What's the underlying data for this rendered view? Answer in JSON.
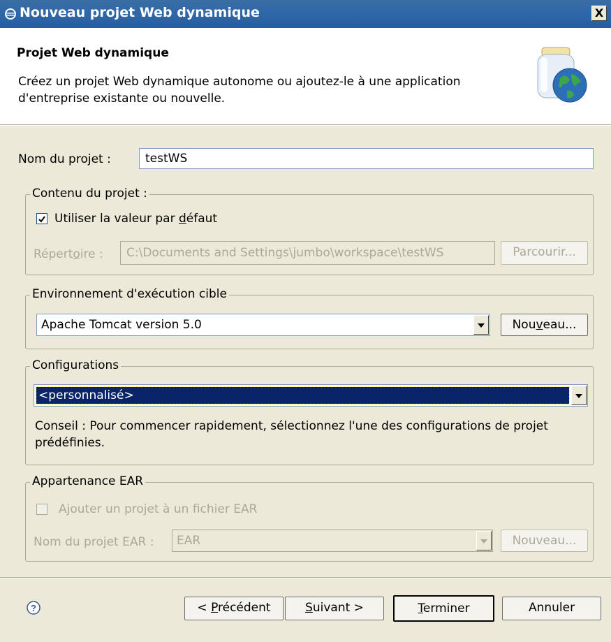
{
  "window": {
    "title": "Nouveau projet Web dynamique",
    "close_label": "X"
  },
  "header": {
    "title": "Projet Web dynamique",
    "description_line1": "Créez un projet Web dynamique autonome ou ajoutez-le à une application",
    "description_line2": "d'entreprise existante ou nouvelle."
  },
  "project_name": {
    "label": "Nom du projet :",
    "value": "testWS"
  },
  "contents": {
    "legend": "Contenu du projet :",
    "use_default": {
      "label_before": "Utiliser la valeur par ",
      "label_mnemonic": "d",
      "label_after": "éfaut",
      "checked": true
    },
    "directory": {
      "label_before": "Répert",
      "label_mnemonic": "o",
      "label_after": "ire :",
      "value": "C:\\Documents and Settings\\jumbo\\workspace\\testWS",
      "browse_label": "Parcourir..."
    }
  },
  "runtime": {
    "legend": "Environnement d'exécution cible",
    "selected": "Apache Tomcat version 5.0",
    "new_before": "Nou",
    "new_mnemonic": "v",
    "new_after": "eau..."
  },
  "configurations": {
    "legend": "Configurations",
    "selected": "<personnalisé>",
    "hint_line1": "Conseil : Pour commencer rapidement, sélectionnez l'une des configurations de projet",
    "hint_line2": "prédéfinies."
  },
  "ear": {
    "legend": "Appartenance EAR",
    "add_label": "Ajouter un projet à un fichier EAR",
    "add_checked": false,
    "name_label": "Nom du projet EAR :",
    "name_value": "EAR",
    "new_label": "Nouveau..."
  },
  "footer": {
    "help_icon": "question-circle-icon",
    "prev": {
      "before": "< ",
      "mnemonic": "P",
      "after": "récédent"
    },
    "next": {
      "mnemonic": "S",
      "after": "uivant >"
    },
    "finish": {
      "mnemonic": "T",
      "after": "erminer"
    },
    "cancel": "Annuler"
  }
}
